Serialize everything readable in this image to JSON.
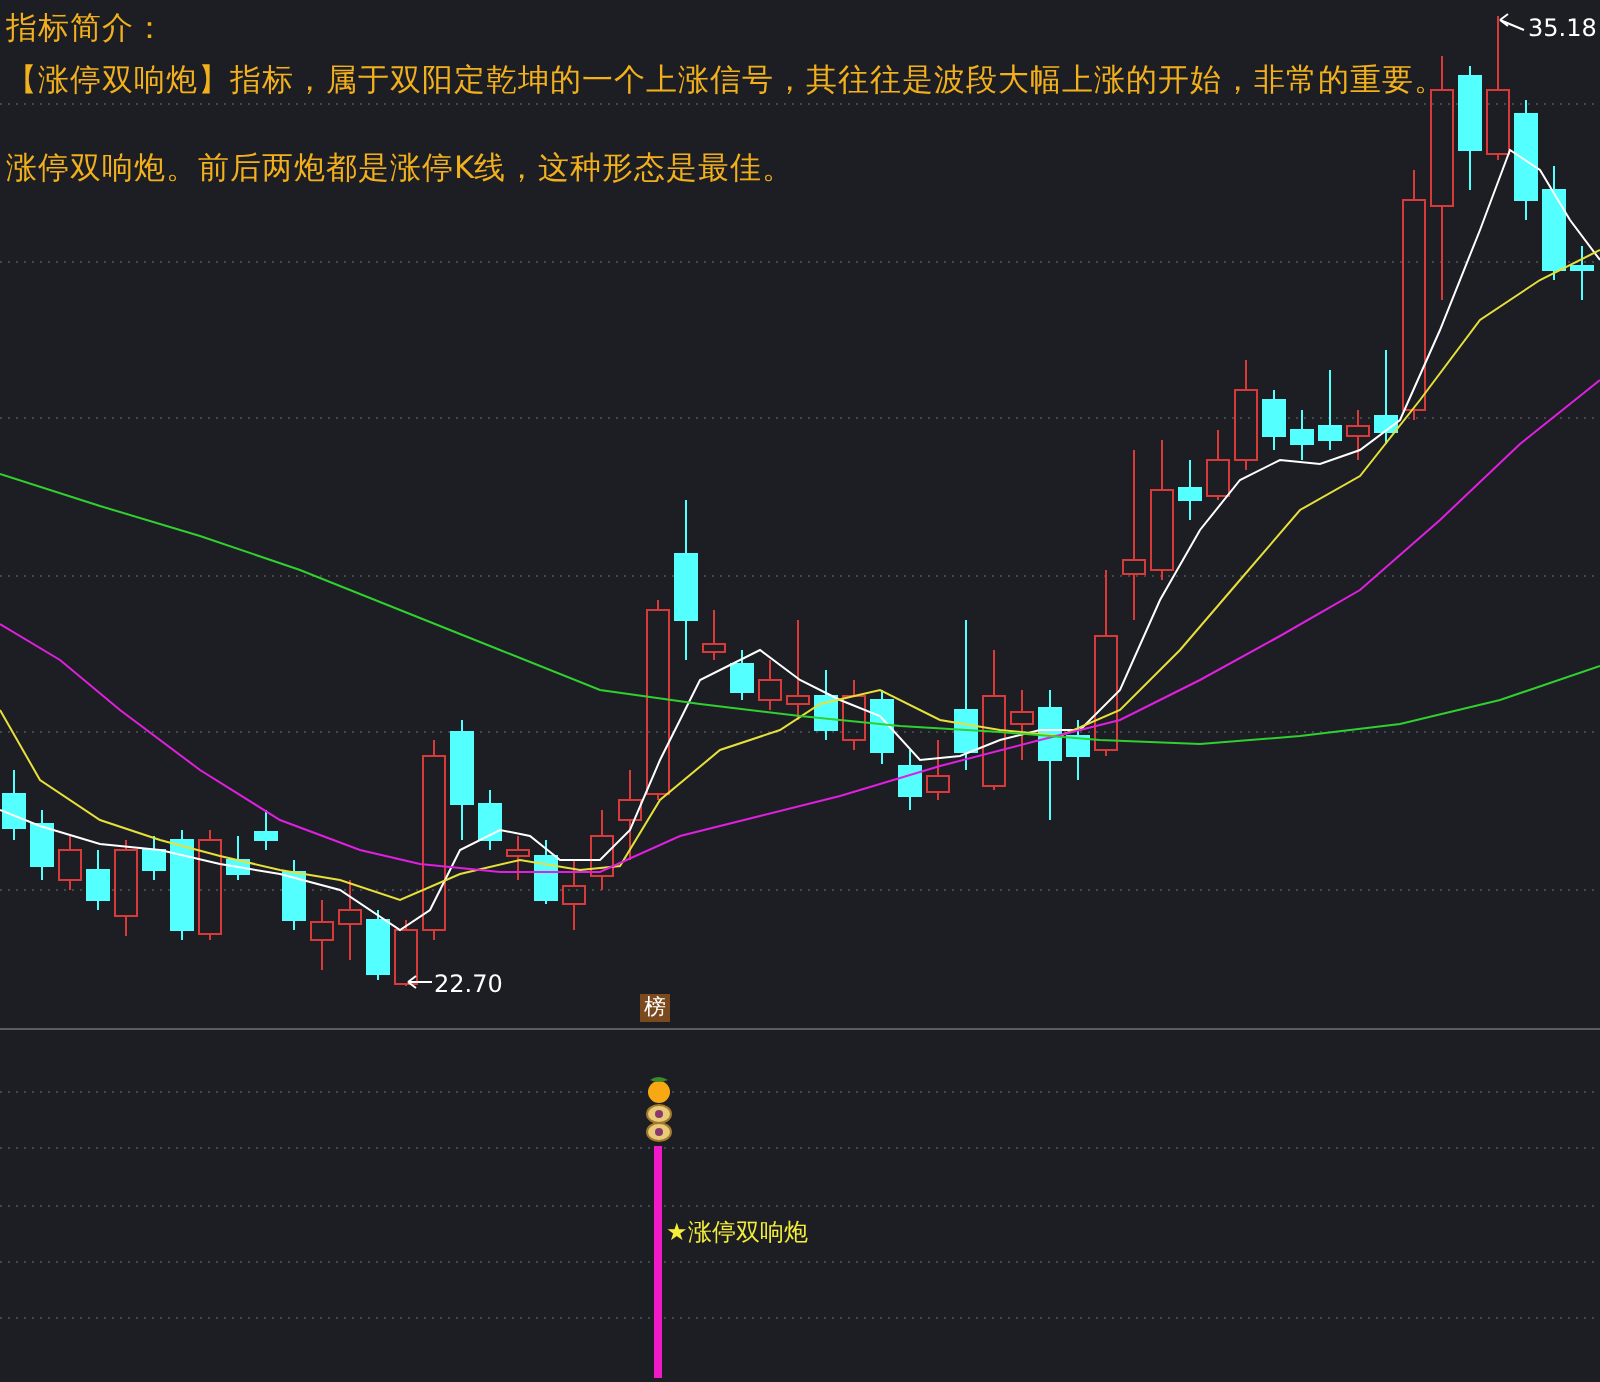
{
  "intro": {
    "title": "指标简介：",
    "lines": [
      "【涨停双响炮】指标，属于双阳定乾坤的一个上涨信号，其往往是波段大幅上涨的开始，非常的重要。",
      "涨停双响炮。前后两炮都是涨停K线，这种形态是最佳。"
    ]
  },
  "chart": {
    "high_label": "35.18",
    "low_label": "22.70",
    "badge": "榜"
  },
  "indicator": {
    "signal_label": "★涨停双响炮"
  }
}
